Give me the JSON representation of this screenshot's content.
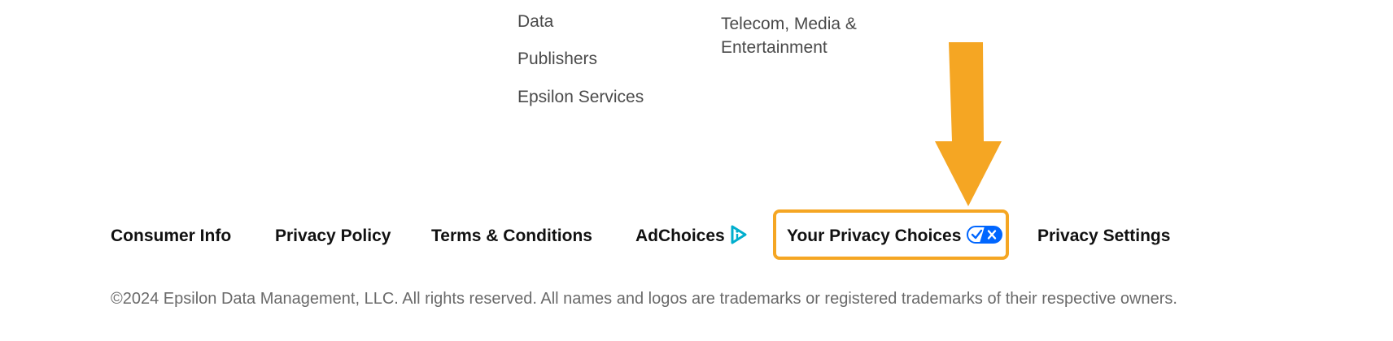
{
  "nav": {
    "col1": [
      "Data",
      "Publishers",
      "Epsilon Services"
    ],
    "col2": {
      "line1": "Telecom, Media &",
      "line2": "Entertainment"
    }
  },
  "footer": {
    "links": {
      "consumer_info": "Consumer Info",
      "privacy_policy": "Privacy Policy",
      "terms": "Terms & Conditions",
      "adchoices": "AdChoices",
      "privacy_choices": "Your Privacy Choices",
      "privacy_settings": "Privacy Settings"
    },
    "copyright": "©2024 Epsilon Data Management, LLC. All rights reserved. All names and logos are trademarks or registered trademarks of their respective owners."
  },
  "icons": {
    "adchoices": "adchoices-icon",
    "privacy_toggle": "privacy-toggle-icon",
    "arrow": "down-arrow-icon"
  },
  "colors": {
    "highlight": "#f5a623",
    "adchoices_cyan": "#00aecd",
    "toggle_blue": "#0066ff"
  }
}
